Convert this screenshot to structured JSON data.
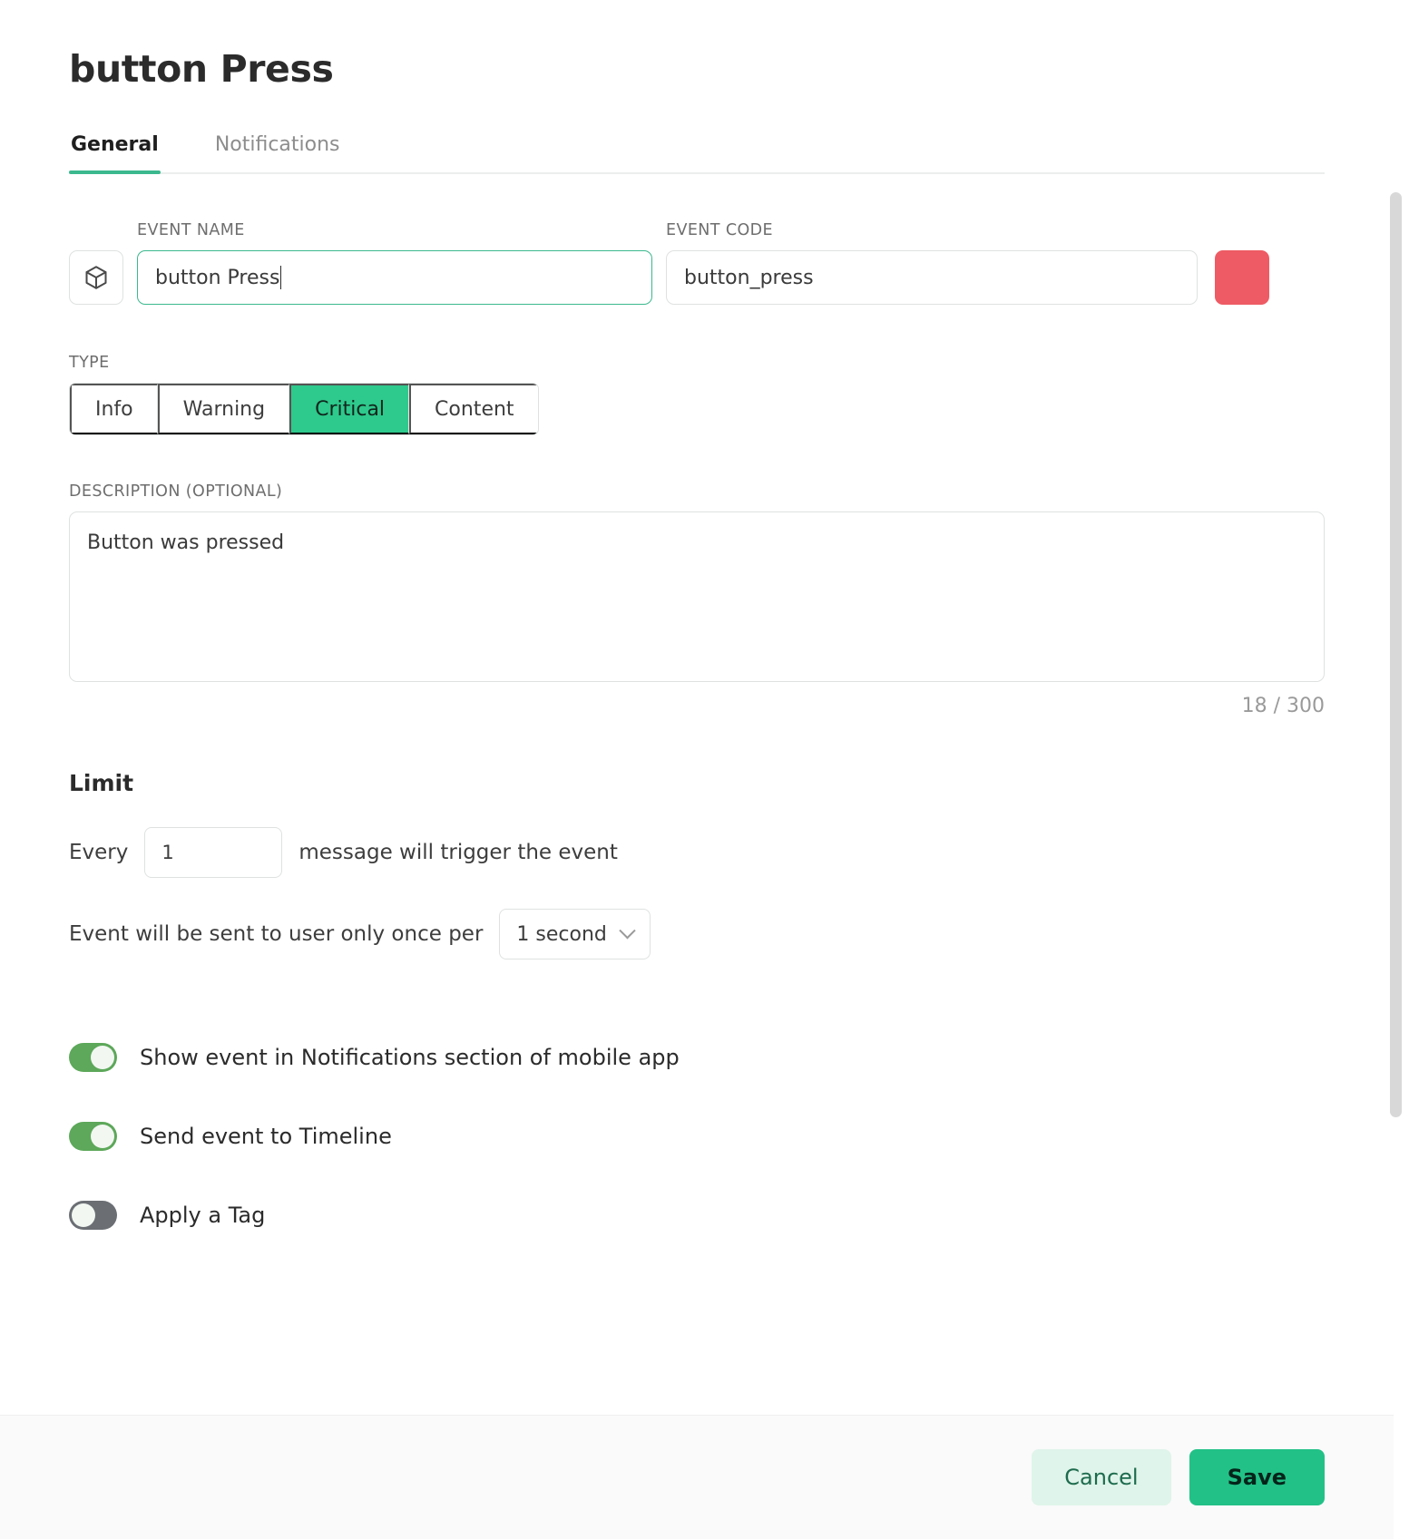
{
  "dialog": {
    "title": "button Press"
  },
  "tabs": [
    {
      "label": "General",
      "active": true
    },
    {
      "label": "Notifications",
      "active": false
    }
  ],
  "fields": {
    "event_name": {
      "label": "EVENT NAME",
      "value": "button Press",
      "icon": "cube-icon",
      "focused": true
    },
    "event_code": {
      "label": "EVENT CODE",
      "value": "button_press"
    },
    "color": {
      "value": "#ee5b64"
    },
    "type": {
      "label": "TYPE",
      "options": [
        "Info",
        "Warning",
        "Critical",
        "Content"
      ],
      "selected": "Critical"
    },
    "description": {
      "label": "DESCRIPTION (OPTIONAL)",
      "value": "Button was pressed",
      "counter": "18 / 300"
    }
  },
  "limit": {
    "heading": "Limit",
    "every_prefix": "Every",
    "every_value": "1",
    "every_suffix": "message will trigger the event",
    "once_prefix": "Event will be sent to user only once per",
    "once_value": "1 second"
  },
  "toggles": [
    {
      "label": "Show event in Notifications section of mobile app",
      "on": true
    },
    {
      "label": "Send event to Timeline",
      "on": true
    },
    {
      "label": "Apply a Tag",
      "on": false
    }
  ],
  "footer": {
    "cancel_label": "Cancel",
    "save_label": "Save"
  },
  "colors": {
    "accent_green": "#2ec98c",
    "tab_underline": "#3bb88e",
    "swatch_red": "#ee5b64",
    "toggle_on": "#5da85a",
    "toggle_off": "#6b6f74"
  }
}
